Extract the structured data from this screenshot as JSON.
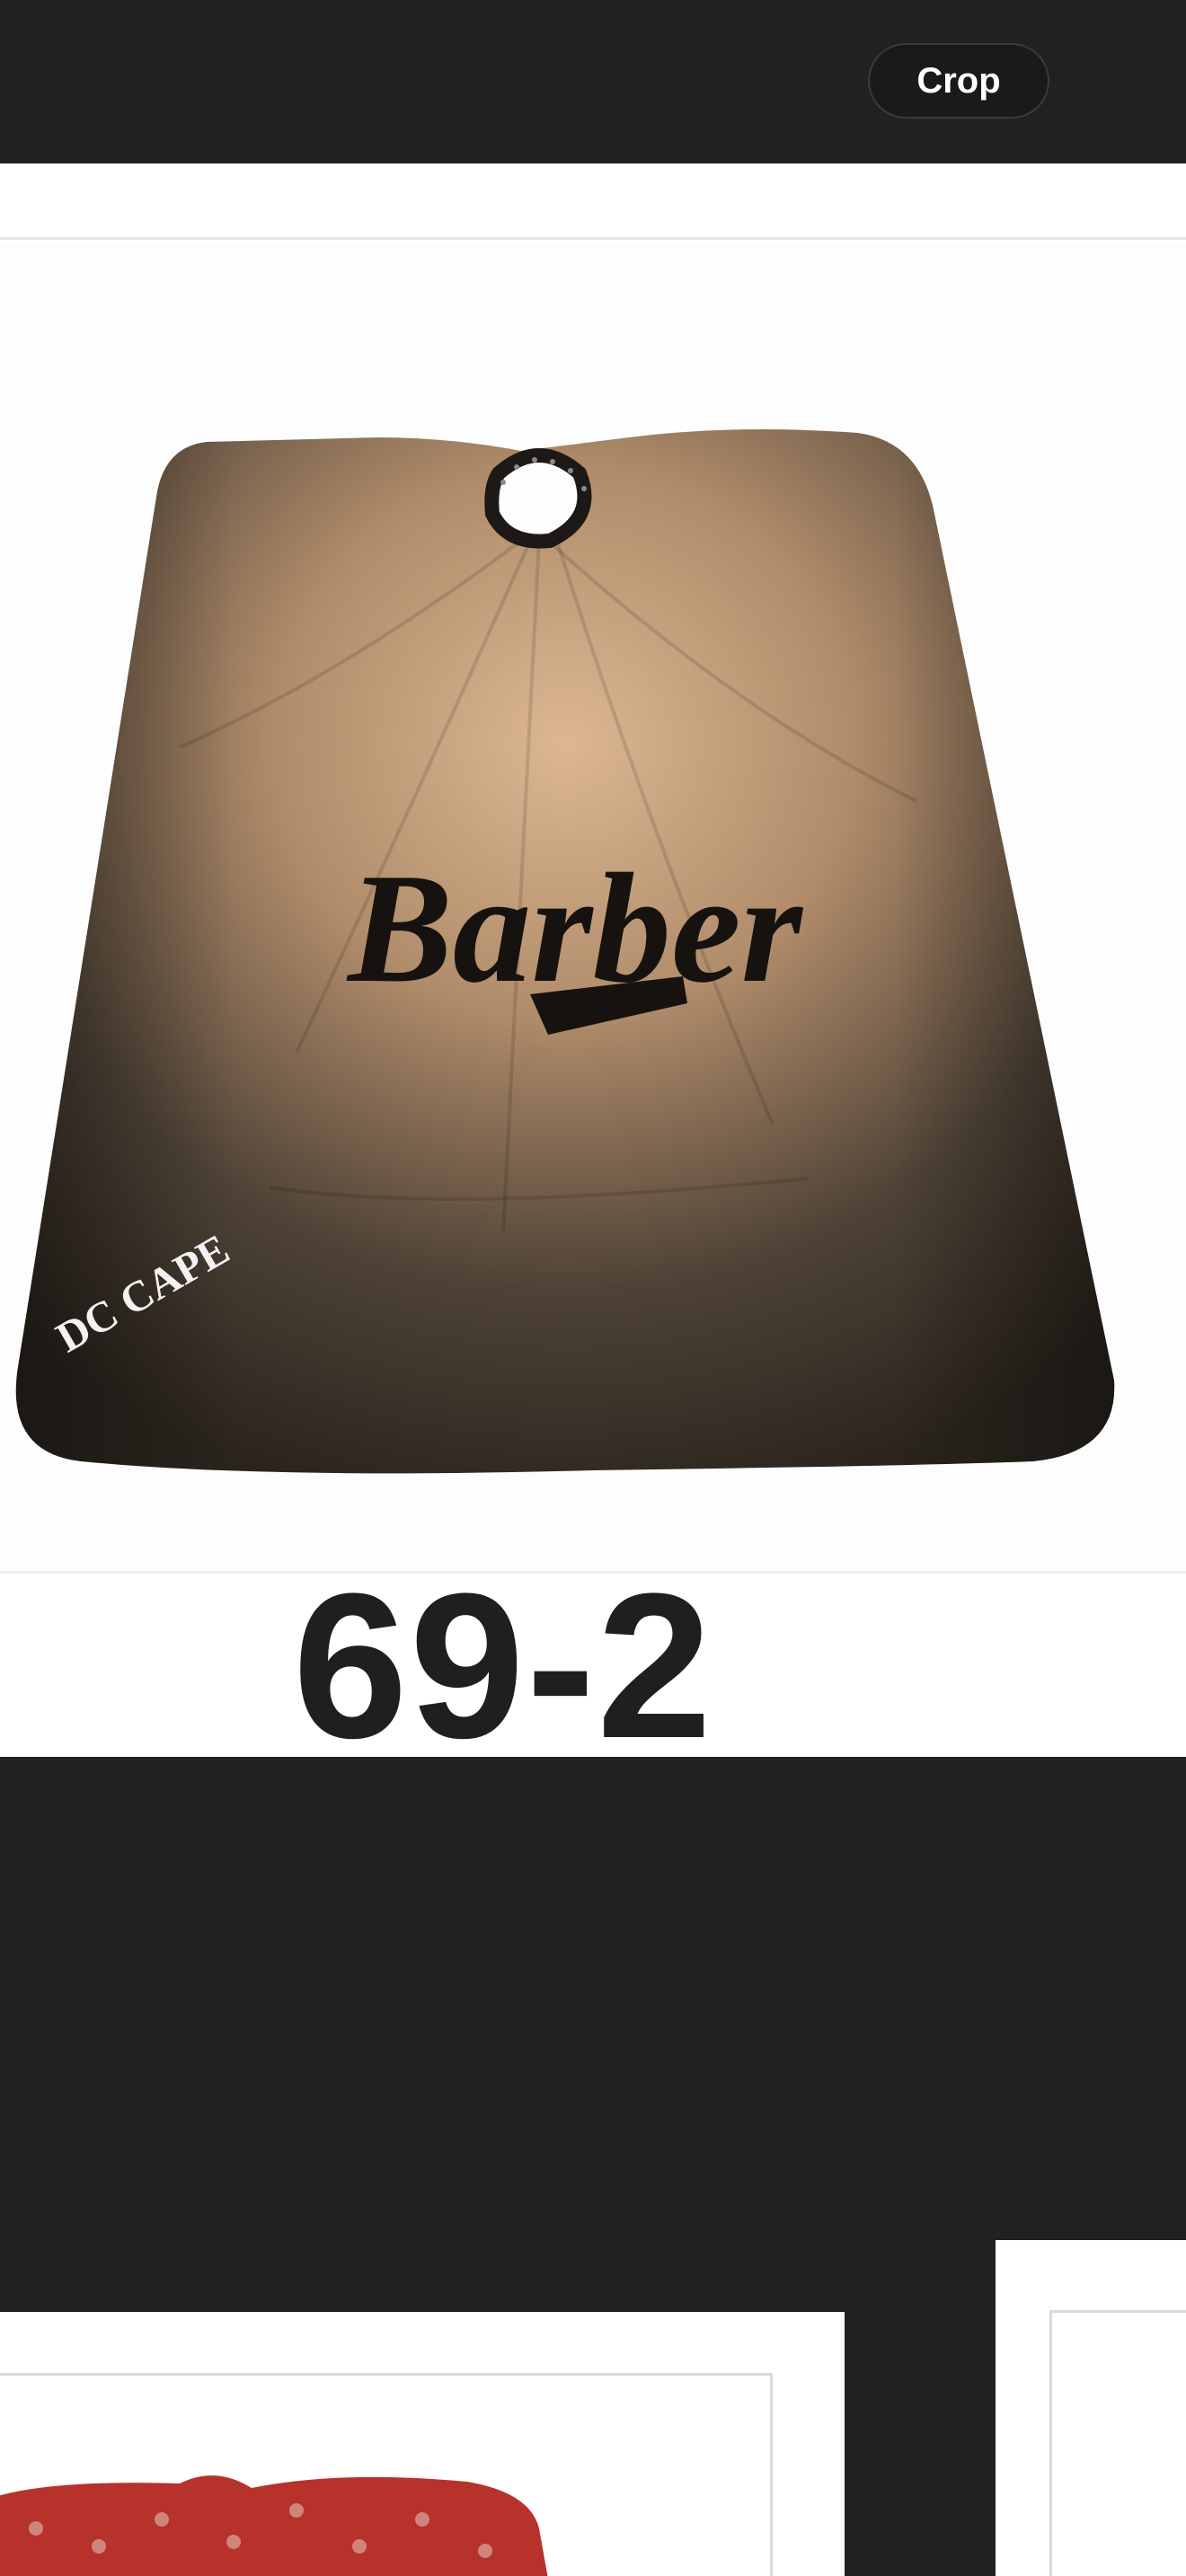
{
  "toolbar": {
    "crop_label": "Crop"
  },
  "product": {
    "code": "69-2",
    "cape_logo_text": "Barber",
    "corner_mark_text": "DC CAPE"
  },
  "colors": {
    "background": "#212121",
    "card": "#ffffff",
    "cape_center": "#d9b48f",
    "cape_edge": "#2a241d",
    "red_cape": "#b8322c"
  }
}
